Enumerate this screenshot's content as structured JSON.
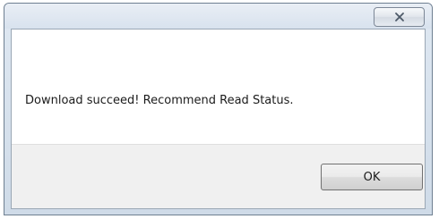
{
  "dialog": {
    "message": "Download succeed! Recommend Read Status.",
    "ok_label": "OK",
    "close_icon": "close-icon"
  },
  "colors": {
    "frame": "#cfdbe8",
    "content_bg": "#ffffff",
    "footer_bg": "#f0f0f0",
    "text": "#1b1b1b"
  }
}
